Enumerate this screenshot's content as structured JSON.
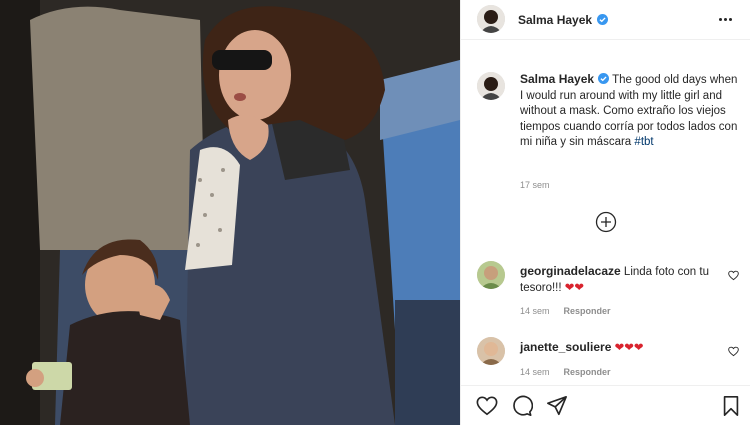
{
  "post": {
    "author": "Salma Hayek",
    "caption_text": "The good old days when I would run around with my little girl and without a mask. Como extraño los viejos tiempos cuando corría por todos lados con mi niña y sin máscara",
    "hashtag": "#tbt",
    "time_ago": "17 sem"
  },
  "icons": {
    "header": [
      "verified-badge-icon",
      "more-options-icon"
    ],
    "load_more": "plus-circle-icon",
    "actions": [
      "heart-icon",
      "comment-icon",
      "share-icon",
      "bookmark-icon"
    ]
  },
  "comments": [
    {
      "username": "georginadelacaze",
      "text": "Linda foto con tu tesoro!!!",
      "emoji": "❤❤",
      "time_ago": "14 sem",
      "reply_label": "Responder"
    },
    {
      "username": "janette_souliere",
      "text": "",
      "emoji": "❤❤❤",
      "time_ago": "14 sem",
      "reply_label": "Responder"
    }
  ],
  "colors": {
    "text": "#262626",
    "secondary_text": "#8e8e8e",
    "link": "#00376b",
    "verified": "#3897f0",
    "heart_emoji": "#d9232e",
    "divider": "#efefef"
  }
}
